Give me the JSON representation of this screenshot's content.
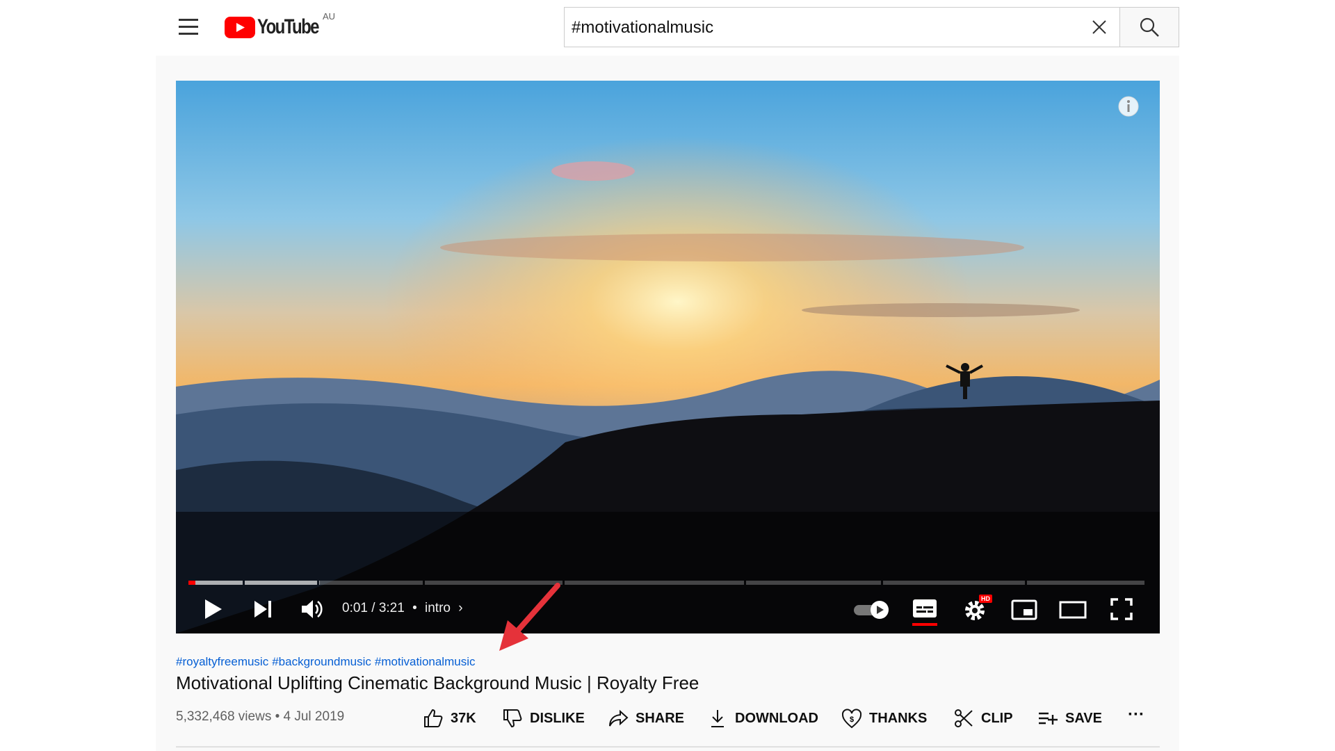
{
  "header": {
    "logo_text": "YouTube",
    "region": "AU",
    "search_value": "#motivationalmusic"
  },
  "player": {
    "time": "0:01 / 3:21",
    "chapter": "intro",
    "chapter_separator": "•",
    "progress_fraction": 0.005,
    "buffered_fraction": 0.137,
    "autoplay": true,
    "quality_badge": "HD",
    "accent": "#ff0000"
  },
  "video": {
    "hashtags": [
      "#royaltyfreemusic",
      "#backgroundmusic",
      "#motivationalmusic"
    ],
    "title": "Motivational Uplifting Cinematic Background Music | Royalty Free",
    "meta": "5,332,468 views • 4 Jul 2019",
    "actions": {
      "like": "37K",
      "dislike": "DISLIKE",
      "share": "SHARE",
      "download": "DOWNLOAD",
      "thanks": "THANKS",
      "clip": "CLIP",
      "save": "SAVE",
      "more": "···"
    }
  }
}
